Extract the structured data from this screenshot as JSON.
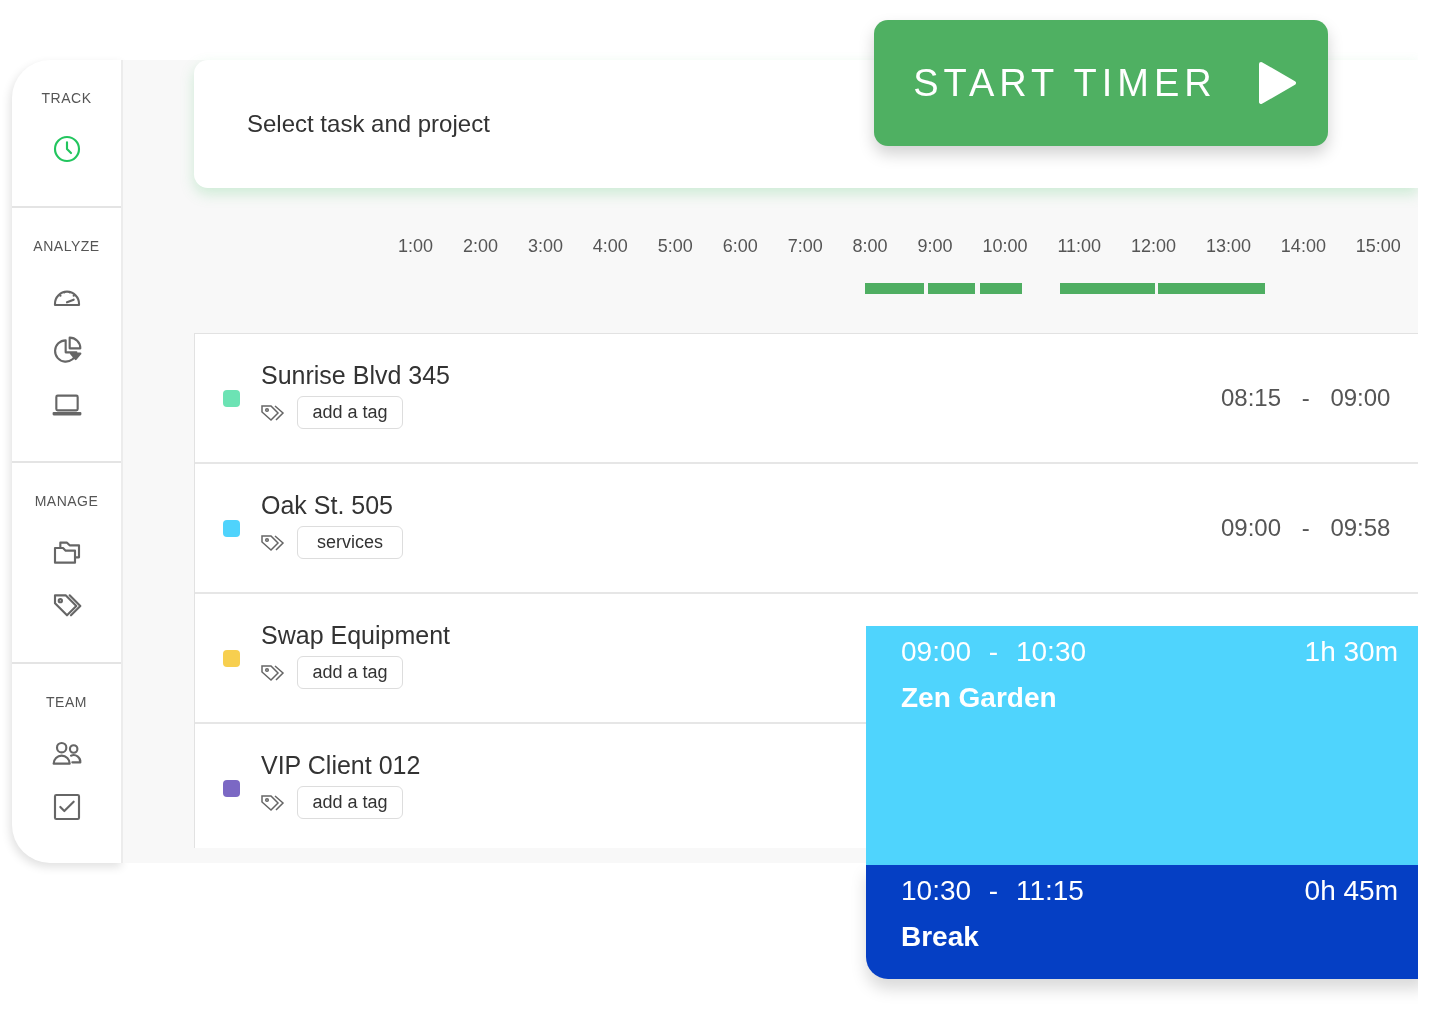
{
  "sidebar": {
    "sections": [
      {
        "heading": "TRACK",
        "items": [
          {
            "kind": "clock",
            "selected": true
          }
        ]
      },
      {
        "heading": "ANALYZE",
        "items": [
          {
            "kind": "gauge",
            "selected": false
          },
          {
            "kind": "pie",
            "selected": false
          },
          {
            "kind": "laptop",
            "selected": false
          }
        ]
      },
      {
        "heading": "MANAGE",
        "items": [
          {
            "kind": "folders",
            "selected": false
          },
          {
            "kind": "tags",
            "selected": false
          }
        ]
      },
      {
        "heading": "TEAM",
        "items": [
          {
            "kind": "people",
            "selected": false
          },
          {
            "kind": "checkbox",
            "selected": false
          }
        ]
      }
    ]
  },
  "task_field": {
    "placeholder": "Select task and project"
  },
  "start_button": {
    "label": "START TIMER"
  },
  "timeline": {
    "hours": [
      "1:00",
      "2:00",
      "3:00",
      "4:00",
      "5:00",
      "6:00",
      "7:00",
      "8:00",
      "9:00",
      "10:00",
      "11:00",
      "12:00",
      "13:00",
      "14:00",
      "15:00"
    ]
  },
  "entries": [
    {
      "title": "Sunrise Blvd 345",
      "color": "#6ce3b4",
      "tag": "add a tag",
      "time_range": "08:15 - 09:00"
    },
    {
      "title": "Oak St. 505",
      "color": "#4fd3fc",
      "tag": "services",
      "time_range": "09:00 - 09:58"
    },
    {
      "title": "Swap Equipment",
      "color": "#f7cf4f",
      "tag": "add a tag"
    },
    {
      "title": "VIP Client 012",
      "color": "#7b68c4",
      "tag": "add a tag"
    }
  ],
  "calendar_blocks": [
    {
      "time_range": "09:00 - 10:30",
      "duration": "1h 30m",
      "title": "Zen Garden",
      "color": "#4fd4fd"
    },
    {
      "time_range": "10:30 - 11:15",
      "duration": "0h 45m",
      "title": "Break",
      "color": "#053fc4"
    }
  ]
}
